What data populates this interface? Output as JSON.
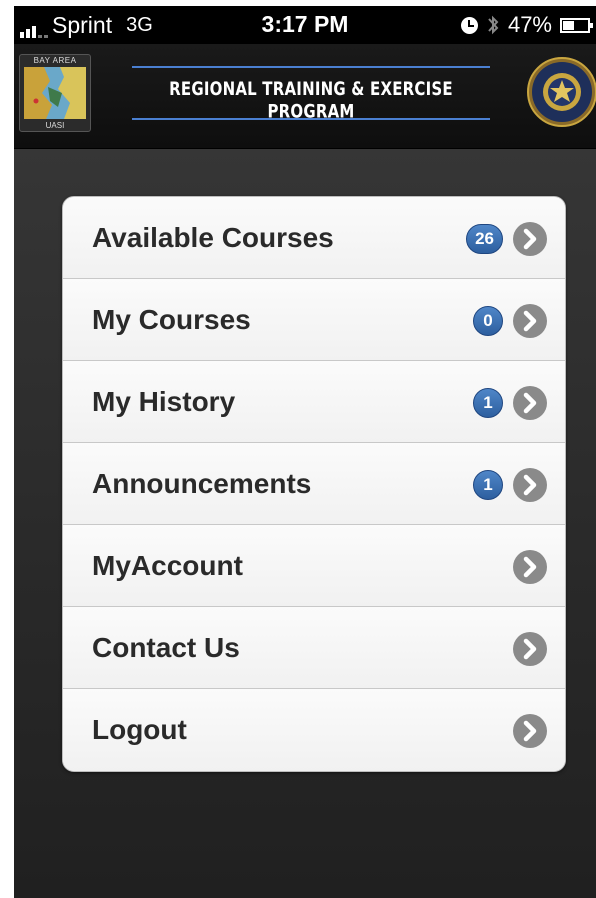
{
  "status_bar": {
    "carrier": "Sprint",
    "network": "3G",
    "time": "3:17 PM",
    "battery_percent": "47%",
    "battery_level": 0.47,
    "signal_bars": 3,
    "icons": [
      "signal-icon",
      "alarm-icon",
      "bluetooth-icon",
      "battery-icon"
    ]
  },
  "header": {
    "left_logo_top": "BAY AREA",
    "left_logo_bottom": "UASI",
    "title": "REGIONAL TRAINING & EXERCISE PROGRAM",
    "right_logo": "sheriff-badge-logo"
  },
  "menu": {
    "items": [
      {
        "label": "Available Courses",
        "badge": "26"
      },
      {
        "label": "My Courses",
        "badge": "0"
      },
      {
        "label": "My History",
        "badge": "1"
      },
      {
        "label": "Announcements",
        "badge": "1"
      },
      {
        "label": "MyAccount",
        "badge": null
      },
      {
        "label": "Contact Us",
        "badge": null
      },
      {
        "label": "Logout",
        "badge": null
      }
    ]
  },
  "colors": {
    "badge_blue": "#3a6fb3",
    "header_line": "#4a7fd1",
    "background": "#2a2a2a"
  }
}
